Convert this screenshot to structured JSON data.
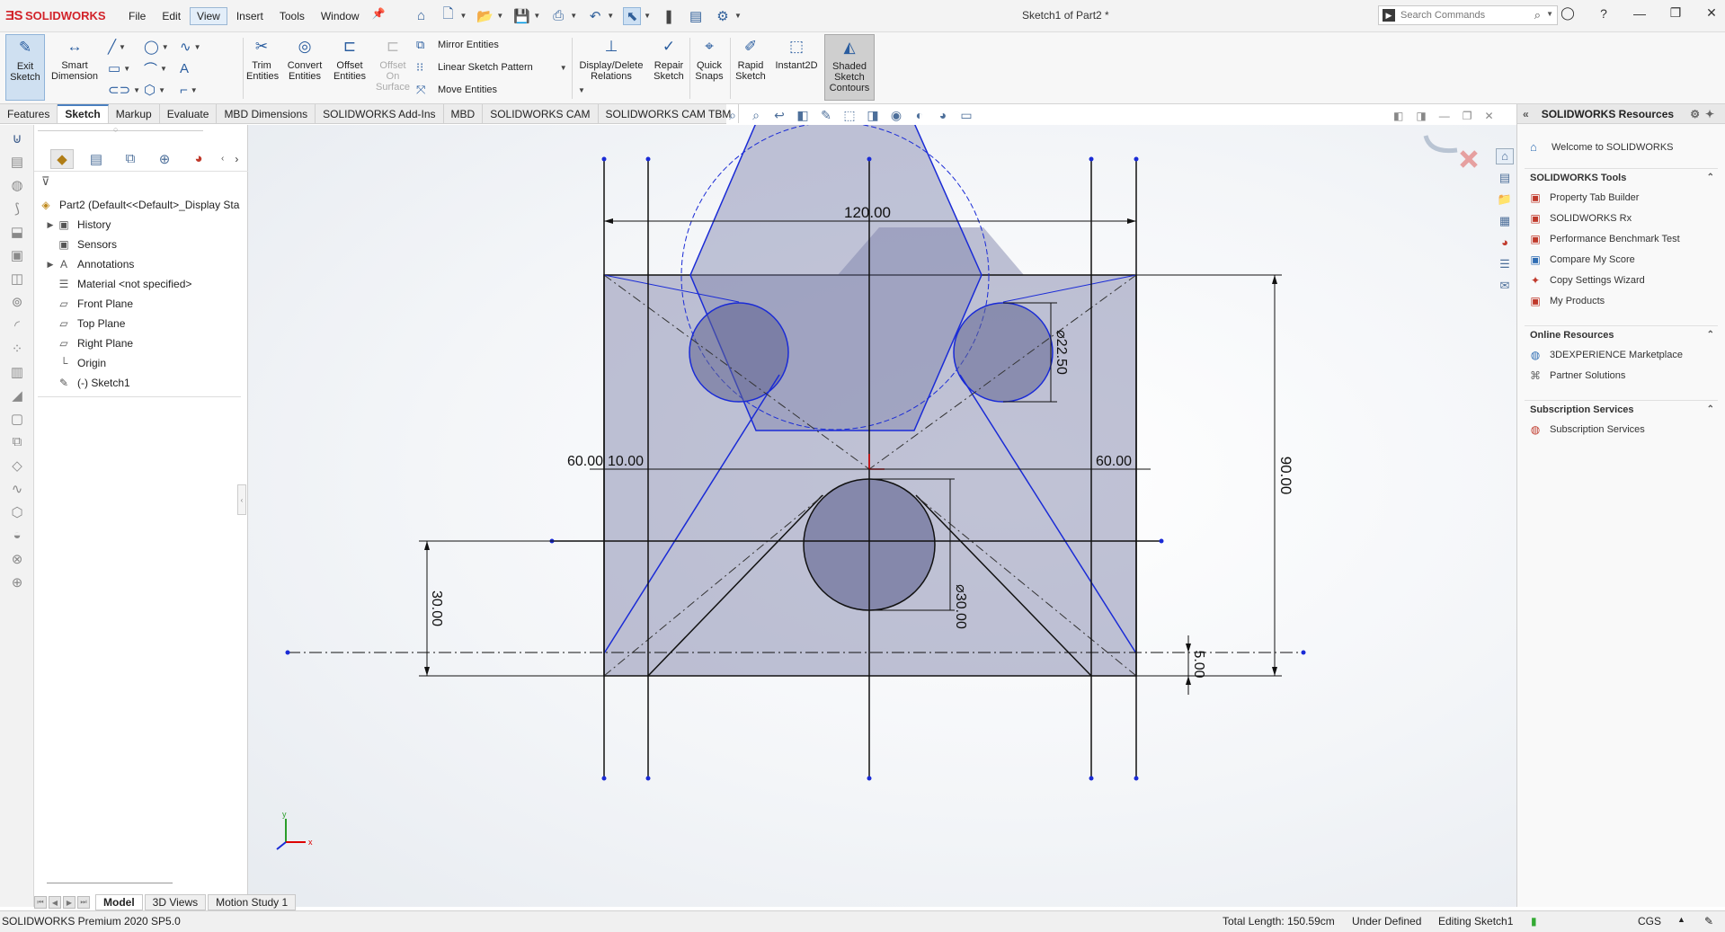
{
  "app": {
    "brand": "SOLIDWORKS",
    "document_title": "Sketch1 of Part2 *",
    "search_placeholder": "Search Commands"
  },
  "menus": [
    "File",
    "Edit",
    "View",
    "Insert",
    "Tools",
    "Window"
  ],
  "active_menu": "View",
  "commands": {
    "exit_sketch": "Exit Sketch",
    "smart_dimension": "Smart Dimension",
    "trim_entities": "Trim Entities",
    "convert_entities": "Convert Entities",
    "offset_entities": "Offset Entities",
    "offset_on_surface": "Offset On Surface",
    "mirror_entities": "Mirror Entities",
    "linear_sketch_pattern": "Linear Sketch Pattern",
    "move_entities": "Move Entities",
    "display_delete_relations": "Display/Delete Relations",
    "repair_sketch": "Repair Sketch",
    "quick_snaps": "Quick Snaps",
    "rapid_sketch": "Rapid Sketch",
    "instant2d": "Instant2D",
    "shaded_sketch_contours": "Shaded Sketch Contours"
  },
  "tabs": [
    "Features",
    "Sketch",
    "Markup",
    "Evaluate",
    "MBD Dimensions",
    "SOLIDWORKS Add-Ins",
    "MBD",
    "SOLIDWORKS CAM",
    "SOLIDWORKS CAM TBM"
  ],
  "active_tab": "Sketch",
  "feature_tree": {
    "root": "Part2  (Default<<Default>_Display Sta",
    "items": [
      {
        "label": "History",
        "icon": "history-folder-icon",
        "expandable": true
      },
      {
        "label": "Sensors",
        "icon": "sensors-icon",
        "expandable": false
      },
      {
        "label": "Annotations",
        "icon": "annotations-icon",
        "expandable": true
      },
      {
        "label": "Material <not specified>",
        "icon": "material-icon",
        "expandable": false
      },
      {
        "label": "Front Plane",
        "icon": "plane-icon",
        "expandable": false
      },
      {
        "label": "Top Plane",
        "icon": "plane-icon",
        "expandable": false
      },
      {
        "label": "Right Plane",
        "icon": "plane-icon",
        "expandable": false
      },
      {
        "label": "Origin",
        "icon": "origin-icon",
        "expandable": false
      },
      {
        "label": "(-) Sketch1",
        "icon": "sketch-icon",
        "expandable": false
      }
    ]
  },
  "bottom_tabs": [
    "Model",
    "3D Views",
    "Motion Study 1"
  ],
  "active_bottom_tab": "Model",
  "dimensions": {
    "width_top": "120.00",
    "left_a": "60.00",
    "left_b": "10.00",
    "right_a": "60.00",
    "hole_small": "⌀22.50",
    "height_right": "90.00",
    "hole_center": "⌀30.00",
    "left_height": "30.00",
    "offset_bottom": "5.00"
  },
  "triad": {
    "x_label": "x",
    "y_label": "y"
  },
  "task_pane": {
    "title": "SOLIDWORKS Resources",
    "welcome": "Welcome to SOLIDWORKS",
    "sections": [
      {
        "title": "SOLIDWORKS Tools",
        "items": [
          "Property Tab Builder",
          "SOLIDWORKS Rx",
          "Performance Benchmark Test",
          "Compare My Score",
          "Copy Settings Wizard",
          "My Products"
        ]
      },
      {
        "title": "Online Resources",
        "items": [
          "3DEXPERIENCE Marketplace",
          "Partner Solutions"
        ]
      },
      {
        "title": "Subscription Services",
        "items": [
          "Subscription Services"
        ]
      }
    ]
  },
  "status": {
    "version": "SOLIDWORKS Premium 2020 SP5.0",
    "total_length": "Total Length: 150.59cm",
    "definition": "Under Defined",
    "mode": "Editing Sketch1",
    "units": "CGS"
  },
  "colors": {
    "accent": "#2a5d9f",
    "sketch_blue": "#1a2bd6",
    "shade": "#8d90b3",
    "brand_red": "#d2232a"
  }
}
